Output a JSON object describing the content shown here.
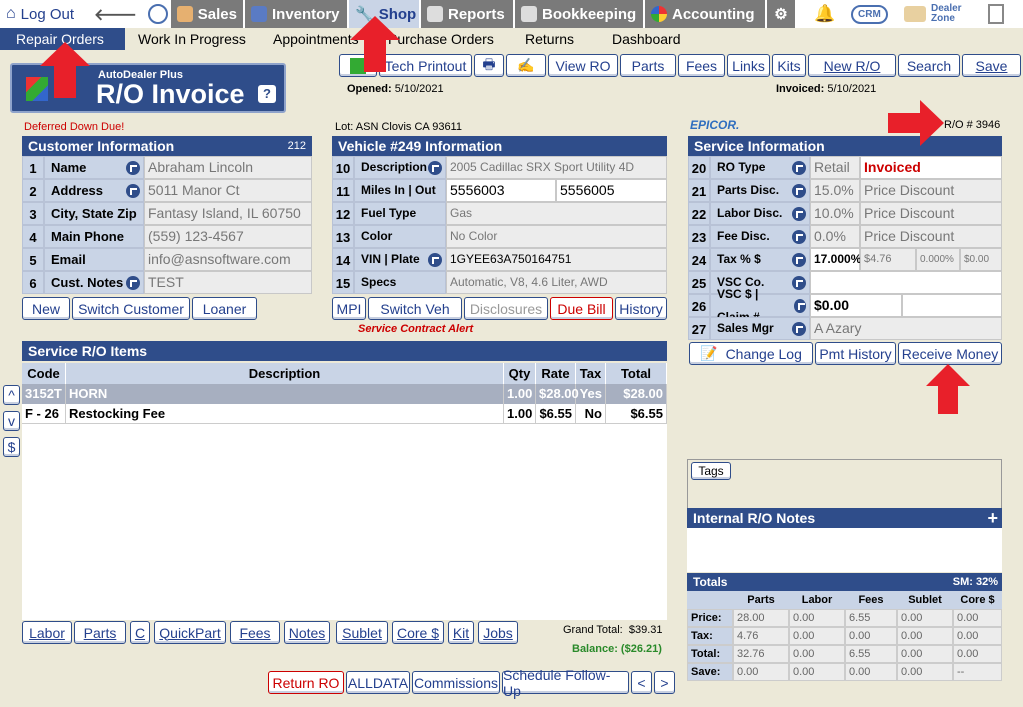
{
  "nav": {
    "logout": "Log Out",
    "sales": "Sales",
    "inventory": "Inventory",
    "shop": "Shop",
    "reports": "Reports",
    "bookkeeping": "Bookkeeping",
    "accounting": "Accounting",
    "crm": "CRM",
    "dealer_zone": "Dealer Zone"
  },
  "subnav": {
    "repair_orders": "Repair Orders",
    "wip": "Work In Progress",
    "appointments": "Appointments",
    "purchase_orders": "Purchase Orders",
    "returns": "Returns",
    "dashboard": "Dashboard"
  },
  "brand": {
    "small": "AutoDealer Plus",
    "big": "R/O Invoice",
    "help": "?"
  },
  "toolbar": {
    "tech_printout": "Tech Printout",
    "view_ro": "View RO",
    "parts": "Parts",
    "fees": "Fees",
    "links": "Links",
    "kits": "Kits",
    "new_ro": "New R/O",
    "search": "Search",
    "save": "Save"
  },
  "dates": {
    "opened_label": "Opened:",
    "opened": "5/10/2021",
    "invoiced_label": "Invoiced:",
    "invoiced": "5/10/2021"
  },
  "alerts": {
    "deferred": "Deferred Down Due!",
    "lot": "Lot: ASN Clovis CA 93611",
    "epicor": "EPICOR.",
    "ro_number": "R/O # 3946",
    "service_contract": "Service Contract Alert"
  },
  "customer": {
    "title": "Customer Information",
    "count": "212",
    "rows": [
      {
        "n": "1",
        "label": "Name",
        "value": "Abraham Lincoln"
      },
      {
        "n": "2",
        "label": "Address",
        "value": "5011 Manor Ct"
      },
      {
        "n": "3",
        "label": "City, State Zip",
        "value": "Fantasy Island, IL 60750"
      },
      {
        "n": "4",
        "label": "Main Phone",
        "value": "(559) 123-4567"
      },
      {
        "n": "5",
        "label": "Email",
        "value": "info@asnsoftware.com"
      },
      {
        "n": "6",
        "label": "Cust. Notes",
        "value": "TEST"
      }
    ],
    "buttons": {
      "new": "New",
      "switch": "Switch Customer",
      "loaner": "Loaner"
    }
  },
  "vehicle": {
    "title": "Vehicle #249 Information",
    "rows": [
      {
        "n": "10",
        "label": "Description",
        "value": "2005 Cadillac SRX Sport Utility 4D"
      },
      {
        "n": "11",
        "label": "Miles In | Out",
        "value": "5556003",
        "value2": "5556005"
      },
      {
        "n": "12",
        "label": "Fuel Type",
        "value": "Gas"
      },
      {
        "n": "13",
        "label": "Color",
        "value": "No Color"
      },
      {
        "n": "14",
        "label": "VIN | Plate",
        "value": "1GYEE63A750164751"
      },
      {
        "n": "15",
        "label": "Specs",
        "value": "Automatic, V8, 4.6 Liter, AWD"
      }
    ],
    "buttons": {
      "mpi": "MPI",
      "switch": "Switch Veh",
      "disclosures": "Disclosures",
      "due_bill": "Due Bill",
      "history": "History"
    }
  },
  "service": {
    "title": "Service Information",
    "rows": [
      {
        "n": "20",
        "label": "RO Type",
        "value": "Retail",
        "value2": "Invoiced"
      },
      {
        "n": "21",
        "label": "Parts Disc.",
        "value": "15.0%",
        "value2": "Price Discount"
      },
      {
        "n": "22",
        "label": "Labor Disc.",
        "value": "10.0%",
        "value2": "Price Discount"
      },
      {
        "n": "23",
        "label": "Fee Disc.",
        "value": "0.0%",
        "value2": "Price Discount"
      },
      {
        "n": "24",
        "label": "Tax % $",
        "value": "17.000%",
        "value2": "$4.76",
        "value3": "0.000%",
        "value4": "$0.00"
      },
      {
        "n": "25",
        "label": "VSC Co.",
        "value": ""
      },
      {
        "n": "26",
        "label": "VSC $ | Claim #",
        "value": "$0.00"
      },
      {
        "n": "27",
        "label": "Sales Mgr",
        "value": "A Azary"
      }
    ],
    "buttons": {
      "change_log": "Change Log",
      "pmt_history": "Pmt History",
      "receive_money": "Receive Money"
    }
  },
  "items": {
    "title": "Service R/O Items",
    "headers": [
      "Code",
      "Description",
      "Qty",
      "Rate",
      "Tax",
      "Total"
    ],
    "rows": [
      {
        "code": "3152T",
        "desc": "HORN",
        "qty": "1.00",
        "rate": "$28.00",
        "tax": "Yes",
        "total": "$28.00"
      },
      {
        "code": "F - 26",
        "desc": "Restocking Fee",
        "qty": "1.00",
        "rate": "$6.55",
        "tax": "No",
        "total": "$6.55"
      }
    ],
    "side": [
      "^",
      "v",
      "$"
    ],
    "bottom": [
      "Labor",
      "Parts",
      "C",
      "QuickPart",
      "Fees",
      "Notes",
      "Sublet",
      "Core $",
      "Kit",
      "Jobs"
    ],
    "grand_total_label": "Grand Total:",
    "grand_total": "$39.31",
    "balance_label": "Balance:",
    "balance": "($26.21)"
  },
  "footer": {
    "return_ro": "Return RO",
    "alldata": "ALLDATA",
    "commissions": "Commissions",
    "schedule": "Schedule Follow-Up",
    "prev": "<",
    "next": ">"
  },
  "tags": {
    "label": "Tags"
  },
  "notes": {
    "title": "Internal R/O Notes",
    "plus": "+"
  },
  "totals": {
    "title": "Totals",
    "sm": "SM: 32%",
    "headers": [
      "",
      "Parts",
      "Labor",
      "Fees",
      "Sublet",
      "Core $"
    ],
    "rows": [
      [
        "Price:",
        "28.00",
        "0.00",
        "6.55",
        "0.00",
        "0.00"
      ],
      [
        "Tax:",
        "4.76",
        "0.00",
        "0.00",
        "0.00",
        "0.00"
      ],
      [
        "Total:",
        "32.76",
        "0.00",
        "6.55",
        "0.00",
        "0.00"
      ],
      [
        "Save:",
        "0.00",
        "0.00",
        "0.00",
        "0.00",
        "--"
      ]
    ]
  }
}
